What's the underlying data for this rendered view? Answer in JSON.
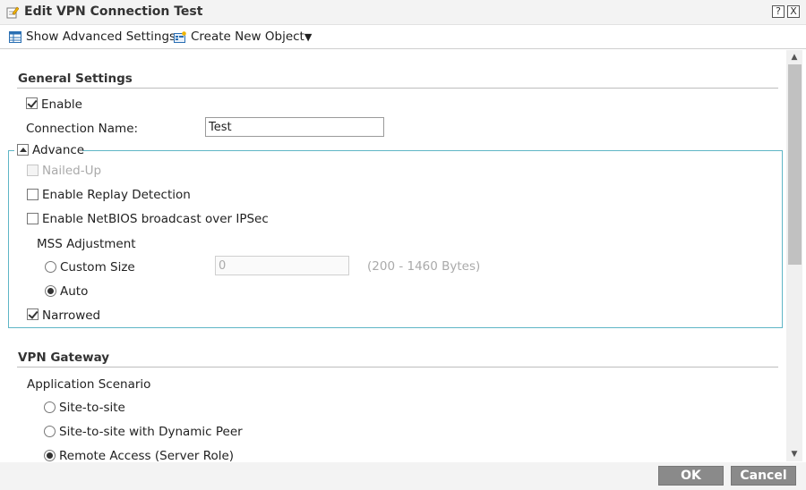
{
  "window": {
    "title": "Edit VPN Connection Test",
    "help_label": "?",
    "close_label": "X"
  },
  "toolbar": {
    "show_advanced_label": "Show Advanced Settings",
    "create_object_label": "Create New Object",
    "create_object_caret": "▼"
  },
  "general": {
    "title": "General Settings",
    "enable_label": "Enable",
    "enable_checked": true,
    "connection_name_label": "Connection Name:",
    "connection_name_value": "Test"
  },
  "advance": {
    "title": "Advance",
    "nailed_up_label": "Nailed-Up",
    "replay_label": "Enable Replay Detection",
    "netbios_label": "Enable NetBIOS broadcast over IPSec",
    "mss_title": "MSS Adjustment",
    "custom_size_label": "Custom Size",
    "custom_size_value": "0",
    "custom_size_range": "(200 - 1460 Bytes)",
    "auto_label": "Auto",
    "narrowed_label": "Narrowed"
  },
  "vpn_gateway": {
    "title": "VPN Gateway",
    "scenario_label": "Application Scenario",
    "options": [
      "Site-to-site",
      "Site-to-site with Dynamic Peer",
      "Remote Access (Server Role)"
    ]
  },
  "footer": {
    "ok_label": "OK",
    "cancel_label": "Cancel"
  },
  "colors": {
    "advance_border": "#5fb6c6",
    "button_bg": "#8a8a8a"
  }
}
